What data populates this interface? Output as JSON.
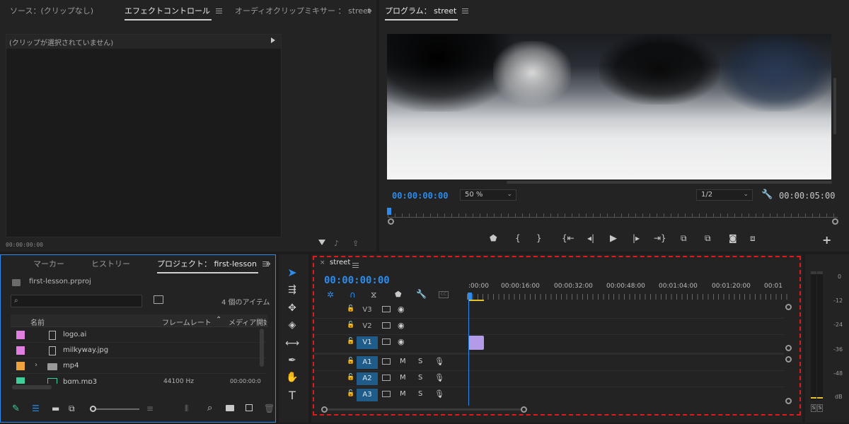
{
  "source_panel": {
    "tabs": {
      "source": "ソース：(クリップなし)",
      "effect_controls": "エフェクトコントロール",
      "audio_mixer": "オーディオクリップミキサー ： street"
    },
    "no_clip_message": "(クリップが選択されていません)",
    "timecode": "00:00:00:00"
  },
  "program_panel": {
    "title": "プログラム： street",
    "timecode": "00:00:00:00",
    "zoom": "50 %",
    "resolution": "1/2",
    "duration": "00:00:05:00"
  },
  "project_panel": {
    "tabs": {
      "markers": "マーカー",
      "history": "ヒストリー",
      "project": "プロジェクト： first-lesson"
    },
    "file_name": "first-lesson.prproj",
    "search_placeholder": "",
    "item_count": "4 個のアイテム",
    "columns": {
      "name": "名前",
      "frame_rate": "フレームレート",
      "media_start": "メディア開始"
    },
    "items": [
      {
        "name": "logo.ai",
        "color": "#e07fe0",
        "kind": "image",
        "frame_rate": "",
        "media_start": ""
      },
      {
        "name": "milkyway.jpg",
        "color": "#e07fe0",
        "kind": "image",
        "frame_rate": "",
        "media_start": ""
      },
      {
        "name": "mp4",
        "color": "#f0a23c",
        "kind": "folder",
        "frame_rate": "",
        "media_start": ""
      },
      {
        "name": "bgm.mp3",
        "color": "#3ccf9a",
        "kind": "audio",
        "frame_rate": "44100 Hz",
        "media_start": "00:00:00:0"
      }
    ]
  },
  "timeline": {
    "sequence_name": "street",
    "timecode": "00:00:00:00",
    "ruler": [
      ":00:00",
      "00:00:16:00",
      "00:00:32:00",
      "00:00:48:00",
      "00:01:04:00",
      "00:01:20:00",
      "00:01"
    ],
    "video_tracks": [
      "V3",
      "V2",
      "V1"
    ],
    "audio_tracks": [
      "A1",
      "A2",
      "A3"
    ],
    "track_buttons": {
      "mute": "M",
      "solo": "S"
    },
    "highlight_color": "#e01a1a"
  },
  "audio_meter": {
    "scale": [
      "0",
      "-12",
      "-24",
      "-36",
      "-48",
      "dB"
    ],
    "solo": [
      "S",
      "S"
    ]
  },
  "colors": {
    "accent": "#2d8ceb",
    "clip": "#b39be8",
    "track_on": "#1f5c8a"
  }
}
